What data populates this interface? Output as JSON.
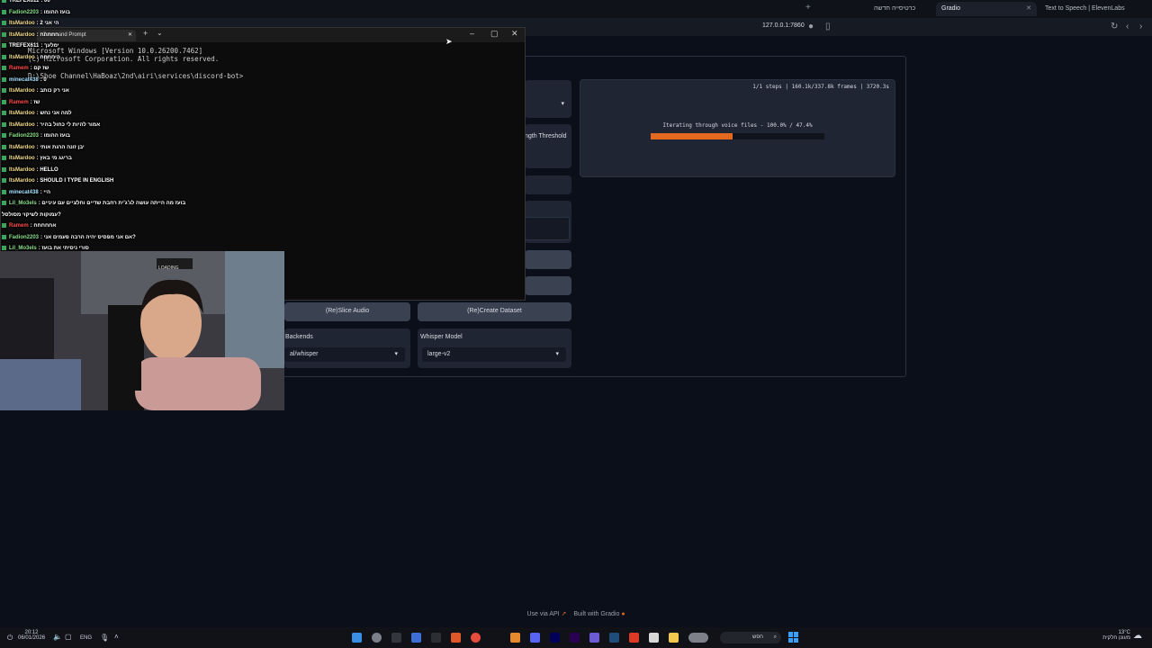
{
  "browser": {
    "tabs": [
      {
        "label": "כרטיסייה חדשה",
        "active": false
      },
      {
        "label": "Gradio",
        "active": true
      },
      {
        "label": "Text to Speech | ElevenLabs",
        "active": false
      }
    ],
    "new_tab_glyph": "+",
    "url": "127.0.0.1:7860"
  },
  "gradio": {
    "threshold_label": "ngth Threshold",
    "status_steps": "1/1 steps | 160.1k/337.8k frames | 3720.3s",
    "iter_label": "Iterating through voice files - 100.0% / 47.4%",
    "progress_fraction": 0.474,
    "slice_button": "(Re)Slice Audio",
    "dataset_button": "(Re)Create Dataset",
    "backends_label": "Backends",
    "backends_value": "al/whisper",
    "whisper_label": "Whisper Model",
    "whisper_value": "large-v2",
    "footer_api": "Use via API",
    "footer_built": "Built with Gradio",
    "accent_color": "#e4691f"
  },
  "cmd": {
    "tab_title": "Command Prompt",
    "lines": [
      "Microsoft Windows [Version 10.0.26200.7462]",
      "(c) Microsoft Corporation. All rights reserved.",
      "",
      "D:\\Shoe Channel\\HaBoaz\\2nd\\airi\\services\\discord-bot>"
    ]
  },
  "chat": [
    {
      "user": "TREFEX611",
      "text": "00",
      "color": "#ffffff"
    },
    {
      "user": "Fadion2203",
      "text": "בועז ההומו",
      "color": "#8be08b"
    },
    {
      "user": "ItsMardoo",
      "text": "הי אני 2",
      "color": "#f2d98a"
    },
    {
      "user": "ItsMardoo",
      "text": "חחחחח",
      "color": "#f2d98a"
    },
    {
      "user": "TREFEX611",
      "text": "ימלעך",
      "color": "#ffffff"
    },
    {
      "user": "ItsMardoo",
      "text": "היחחחח",
      "color": "#f2d98a"
    },
    {
      "user": "Ramem",
      "text": "שז קם",
      "color": "#ff4a4a"
    },
    {
      "user": "minecat438",
      "text": "0",
      "color": "#a6e0ff"
    },
    {
      "user": "ItsMardoo",
      "text": "אני רק כותב",
      "color": "#f2d98a"
    },
    {
      "user": "Ramem",
      "text": "שז",
      "color": "#ff4a4a"
    },
    {
      "user": "ItsMardoo",
      "text": "למה אני נחש",
      "color": "#f2d98a"
    },
    {
      "user": "ItsMardoo",
      "text": "אמור להיות לי כחול בהיר",
      "color": "#f2d98a"
    },
    {
      "user": "Fadion2203",
      "text": "בועז ההומו",
      "color": "#8be08b"
    },
    {
      "user": "ItsMardoo",
      "text": "יבן זונה הרגת אותי",
      "color": "#f2d98a"
    },
    {
      "user": "ItsMardoo",
      "text": "בריגג מי באץ",
      "color": "#f2d98a"
    },
    {
      "user": "ItsMardoo",
      "text": "HELLO",
      "color": "#f2d98a"
    },
    {
      "user": "ItsMardoo",
      "text": "SHOULD I TYPE IN ENGLISH",
      "color": "#f2d98a"
    },
    {
      "user": "minecat438",
      "text": "היי",
      "color": "#a6e0ff"
    },
    {
      "user": "Lil_Mo3els",
      "text": "בועז מה הייתה עושה לג'ג'ית רחבת שדיים וחלציים עם עיניים",
      "color": "#8be08b"
    },
    {
      "user": "",
      "text": "עמוקות לשיקוי מסולסל?",
      "color": "#ffffff"
    },
    {
      "user": "Ramem",
      "text": "אחחחחח",
      "color": "#ff4a4a"
    },
    {
      "user": "Fadion2203",
      "text": "אם אני מפסיס יהיה הרבה פעמים אני?",
      "color": "#8be08b"
    },
    {
      "user": "Lil_Mo3els",
      "text": "סורי ניסיתי את בועז",
      "color": "#8be08b"
    }
  ],
  "webcam": {
    "sign_text": "LOADING"
  },
  "taskbar": {
    "time": "20:12",
    "date": "06/01/2026",
    "lang": "ENG",
    "weather_temp": "13°C",
    "weather_desc": "מעונן חלקית",
    "search_placeholder": "חפש"
  }
}
